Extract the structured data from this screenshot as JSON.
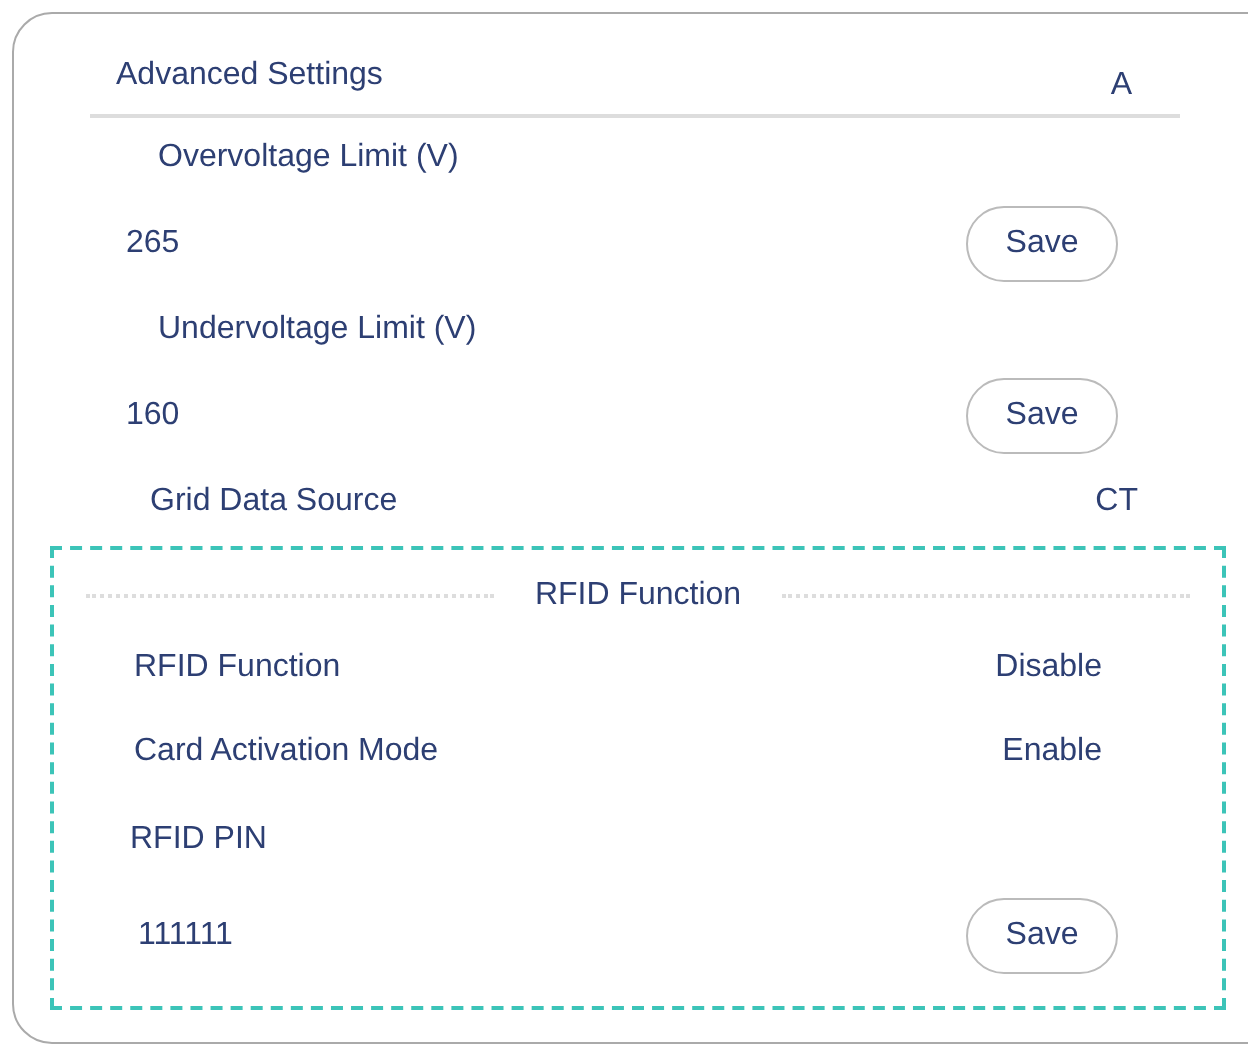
{
  "panel": {
    "title": "Advanced Settings",
    "unit": "A"
  },
  "settings": [
    {
      "kind": "field",
      "label": "Overvoltage Limit (V)",
      "value": "265",
      "button": "Save"
    },
    {
      "kind": "field",
      "label": "Undervoltage Limit (V)",
      "value": "160",
      "button": "Save"
    },
    {
      "kind": "choice",
      "label": "Grid Data Source",
      "value": "CT"
    }
  ],
  "rfid": {
    "title": "RFID Function",
    "settings": [
      {
        "kind": "choice",
        "label": "RFID Function",
        "value": "Disable"
      },
      {
        "kind": "choice",
        "label": "Card Activation Mode",
        "value": "Enable"
      },
      {
        "kind": "field",
        "label": "RFID PIN",
        "value": "111111",
        "button": "Save"
      }
    ]
  }
}
